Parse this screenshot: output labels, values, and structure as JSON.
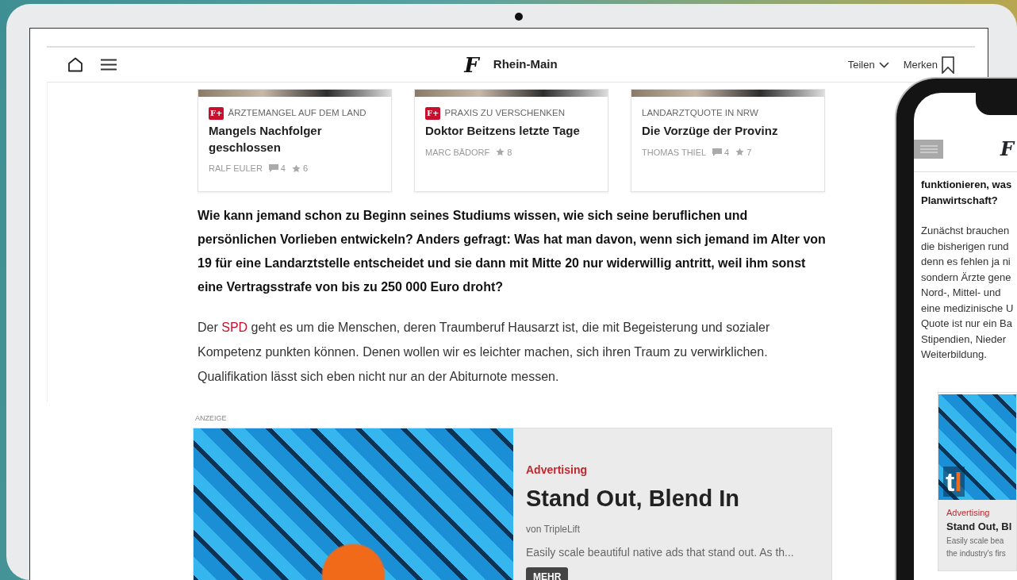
{
  "tablet": {
    "header": {
      "logo": "F",
      "section": "Rhein-Main",
      "share": "Teilen",
      "bookmark": "Merken"
    },
    "teasers": [
      {
        "premium": true,
        "premium_badge": "F+",
        "kicker": "ÄRZTEMANGEL AUF DEM LAND",
        "title": "Mangels Nachfolger geschlossen",
        "author": "RALF EULER",
        "comments": "4",
        "star_count": "6"
      },
      {
        "premium": true,
        "premium_badge": "F+",
        "kicker": "PRAXIS ZU VERSCHENKEN",
        "title": "Doktor Beitzens letzte Tage",
        "author": "MARC BÄDORF",
        "star_count": "8"
      },
      {
        "premium": false,
        "kicker": "LANDARZTQUOTE IN NRW",
        "title": "Die Vorzüge der Provinz",
        "author": "THOMAS THIEL",
        "comments": "4",
        "star_count": "7"
      }
    ],
    "lead_paragraph": "Wie kann jemand schon zu Beginn seines Studiums wissen, wie sich seine beruflichen und persönlichen Vorlieben entwickeln? Anders gefragt: Was hat man davon, wenn sich jemand im Alter von 19 für eine Landarztstelle entscheidet und sie dann mit Mitte 20 nur widerwillig antritt, weil ihm sonst eine Vertragsstrafe von bis zu 250 000 Euro droht?",
    "paragraph": [
      {
        "kind": "text",
        "text": "Der "
      },
      {
        "kind": "link",
        "text": "SPD"
      },
      {
        "kind": "text",
        "text": " geht es um die Menschen, deren Traumberuf Hausarzt ist, die mit Begeisterung und sozialer Kompetenz punkten können. Denen wollen wir es leichter machen, sich ihren Traum zu verwirklichen. Qualifikation lässt sich eben nicht nur an der Abiturnote messen."
      }
    ],
    "ad": {
      "label": "ANZEIGE",
      "category": "Advertising",
      "title": "Stand Out, Blend In",
      "sponsor": "von TripleLift",
      "description": "Easily scale beautiful native ads that stand out. As th...",
      "button": "MEHR"
    }
  },
  "phone": {
    "logo": "F",
    "lead_lines": [
      "funktionieren, was",
      "Planwirtschaft?"
    ],
    "body_lines": [
      "Zunächst brauchen",
      "die bisherigen rund",
      "denn es fehlen ja ni",
      "sondern Ärzte gene",
      "Nord-, Mittel- und",
      "eine medizinische U",
      "Quote ist nur ein Ba",
      "Stipendien, Nieder",
      "Weiterbildung."
    ],
    "ad": {
      "logo": [
        "t",
        "l"
      ],
      "category": "Advertising",
      "title": "Stand Out, Bl",
      "description_lines": [
        "Easily scale bea",
        "the industry's firs"
      ]
    }
  }
}
